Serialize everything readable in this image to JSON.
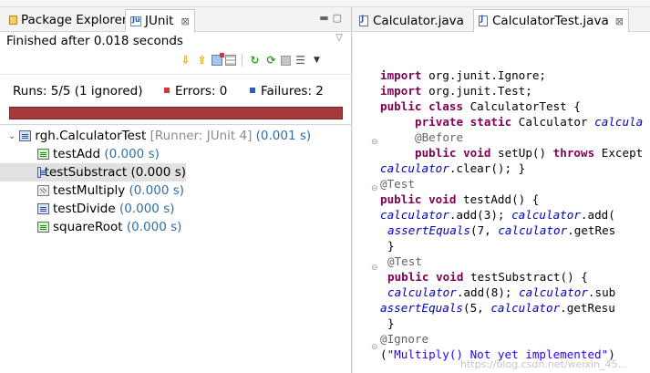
{
  "left_pane": {
    "tabs": [
      {
        "label": "Package Explorer",
        "active": false
      },
      {
        "label": "JUnit",
        "active": true
      }
    ],
    "status": "Finished after 0.018 seconds",
    "counters": {
      "runs": "Runs:  5/5 (1 ignored)",
      "errors": "Errors:  0",
      "failures": "Failures:  2"
    },
    "progress_state": "failed",
    "colors": {
      "progress_bar": "#a63a3a",
      "error_marker": "#d03a3a",
      "failure_marker": "#2f5fb0"
    },
    "tree": {
      "root": {
        "name": "rgh.CalculatorTest",
        "runner": "[Runner: JUnit 4]",
        "time": "(0.001 s)"
      },
      "tests": [
        {
          "name": "testAdd",
          "time": "(0.000 s)",
          "status": "passed"
        },
        {
          "name": "testSubstract",
          "time": "(0.000 s)",
          "status": "failed",
          "selected": true
        },
        {
          "name": "testMultiply",
          "time": "(0.000 s)",
          "status": "ignored"
        },
        {
          "name": "testDivide",
          "time": "(0.000 s)",
          "status": "failed"
        },
        {
          "name": "squareRoot",
          "time": "(0.000 s)",
          "status": "passed"
        }
      ]
    }
  },
  "editor": {
    "tabs": [
      {
        "label": "Calculator.java",
        "active": false
      },
      {
        "label": "CalculatorTest.java",
        "active": true
      }
    ],
    "code": {
      "l1_kw": "import",
      "l1_t": " org.junit.Ignore;",
      "l2_kw": "import",
      "l2_t": " org.junit.Test;",
      "l3_kw": "public class",
      "l3_t": " CalculatorTest {",
      "l4_kw": "private static",
      "l4_t": " Calculator ",
      "l4_f": "calcula",
      "l5_a": "@Before",
      "l6_kw": "public void",
      "l6_t": " setUp() ",
      "l6_kw2": "throws",
      "l6_t2": " Except",
      "l7_f": "calculator",
      "l7_t": ".clear(); }",
      "l8_a": "@Test",
      "l9_kw": "public void",
      "l9_t": " testAdd() {",
      "l10_f": "calculator",
      "l10_t": ".add(3); ",
      "l10_f2": "calculator",
      "l10_t2": ".add(",
      "l11_f": "assertEquals",
      "l11_t": "(7, ",
      "l11_f2": "calculator",
      "l11_t2": ".getRes",
      "l12_t": "}",
      "l13_a": "@Test",
      "l14_kw": "public void",
      "l14_t": " testSubstract() {",
      "l15_f": "calculator",
      "l15_t": ".add(8); ",
      "l15_f2": "calculator",
      "l15_t2": ".sub",
      "l16_f": "assertEquals",
      "l16_t": "(5, ",
      "l16_f2": "calculator",
      "l16_t2": ".getResu",
      "l17_t": "}",
      "l18_a": "@Ignore",
      "l19_t": "(",
      "l19_s": "\"Multiply() Not yet implemented\"",
      "l19_t2": ")"
    },
    "watermark": "https://blog.csdn.net/weixin_45..."
  }
}
